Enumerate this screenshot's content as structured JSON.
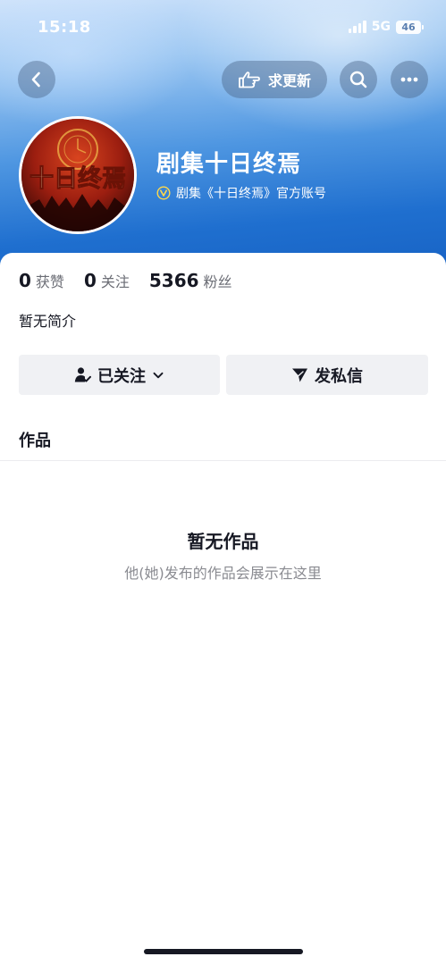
{
  "status_bar": {
    "time": "15:18",
    "network": "5G",
    "battery": "46"
  },
  "nav": {
    "back_icon": "chevron-left-icon",
    "request_update_label": "求更新",
    "request_update_icon": "pointing-hand-icon",
    "search_icon": "search-icon",
    "more_icon": "more-dots-icon"
  },
  "profile": {
    "avatar_text": "十日终焉",
    "name": "剧集十日终焉",
    "verification_icon": "verified-v-icon",
    "verification": "剧集《十日终焉》官方账号",
    "stats": [
      {
        "value": "0",
        "label": "获赞"
      },
      {
        "value": "0",
        "label": "关注"
      },
      {
        "value": "5366",
        "label": "粉丝"
      }
    ],
    "bio": "暂无简介"
  },
  "actions": {
    "follow_label": "已关注",
    "follow_icon": "user-check-icon",
    "follow_chevron_icon": "chevron-down-icon",
    "message_label": "发私信",
    "message_icon": "send-icon"
  },
  "tabs": {
    "works": "作品"
  },
  "empty_state": {
    "title": "暂无作品",
    "subtitle": "他(她)发布的作品会展示在这里"
  },
  "colors": {
    "header_blue": "#1f6fcf",
    "text_primary": "#161823",
    "text_secondary": "#6b6d75",
    "button_bg": "#f0f1f4",
    "avatar_red": "#8e1a0f",
    "avatar_gold": "#f2c14e"
  }
}
